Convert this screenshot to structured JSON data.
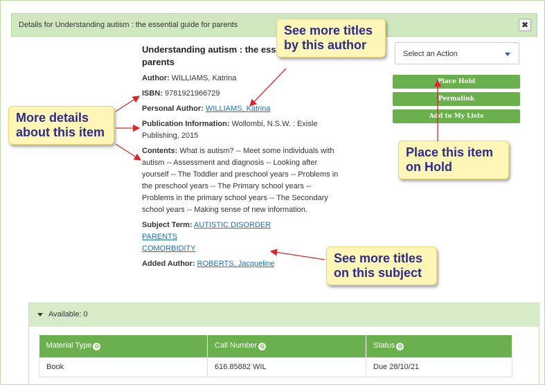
{
  "header": {
    "title": "Details for Understanding autism : the essential guide for parents",
    "close_symbol": "✖"
  },
  "book": {
    "title": "Understanding autism : the essential guide for parents",
    "author_label": "Author:",
    "author": "WILLIAMS, Katrina",
    "isbn_label": "ISBN:",
    "isbn": "9781921966729",
    "personal_author_label": "Personal Author:",
    "personal_author": "WILLIAMS, Katrina",
    "pub_label": "Publication Information:",
    "pub": "Wollombi, N.S.W. : Exisle Publishing, 2015",
    "contents_label": "Contents:",
    "contents": "What is autism? -- Meet some individuals with autism -- Assessment and diagnosis -- Looking after yourself -- The Toddler and preschool years -- Problems in the preschool years -- The Primary school years -- Problems in the primary school years -- The Secondary school years -- Making sense of new information.",
    "subject_label": "Subject Term:",
    "subjects": [
      "AUTISTIC DISORDER",
      "PARENTS",
      "COMORBIDITY"
    ],
    "added_author_label": "Added Author:",
    "added_author": "ROBERTS, Jacqueline"
  },
  "actions": {
    "select_placeholder": "Select an Action",
    "place_hold": "Place Hold",
    "permalink": "Permalink",
    "add_to_lists": "Add to My Lists"
  },
  "callouts": {
    "author": "See more titles by this author",
    "details": "More details about this item",
    "hold": "Place this item on Hold",
    "subject": "See more titles on this subject"
  },
  "availability": {
    "label": "Available: 0",
    "columns": [
      "Material Type",
      "Call Number",
      "Status"
    ],
    "rows": [
      {
        "material_type": "Book",
        "call_number": "616.85882 WIL",
        "status": "Due 28/10/21"
      }
    ]
  },
  "colors": {
    "accent_green": "#6ab04c",
    "header_green": "#cfe8bf",
    "link_blue": "#1a6ec3",
    "callout_yellow": "#fdf6b6",
    "callout_text": "#2c2a8a",
    "arrow_red": "#d9262a"
  },
  "icons": {
    "sort": "sort-icon",
    "close": "close-icon",
    "caret": "chevron-down-icon",
    "expand": "triangle-down-icon"
  }
}
